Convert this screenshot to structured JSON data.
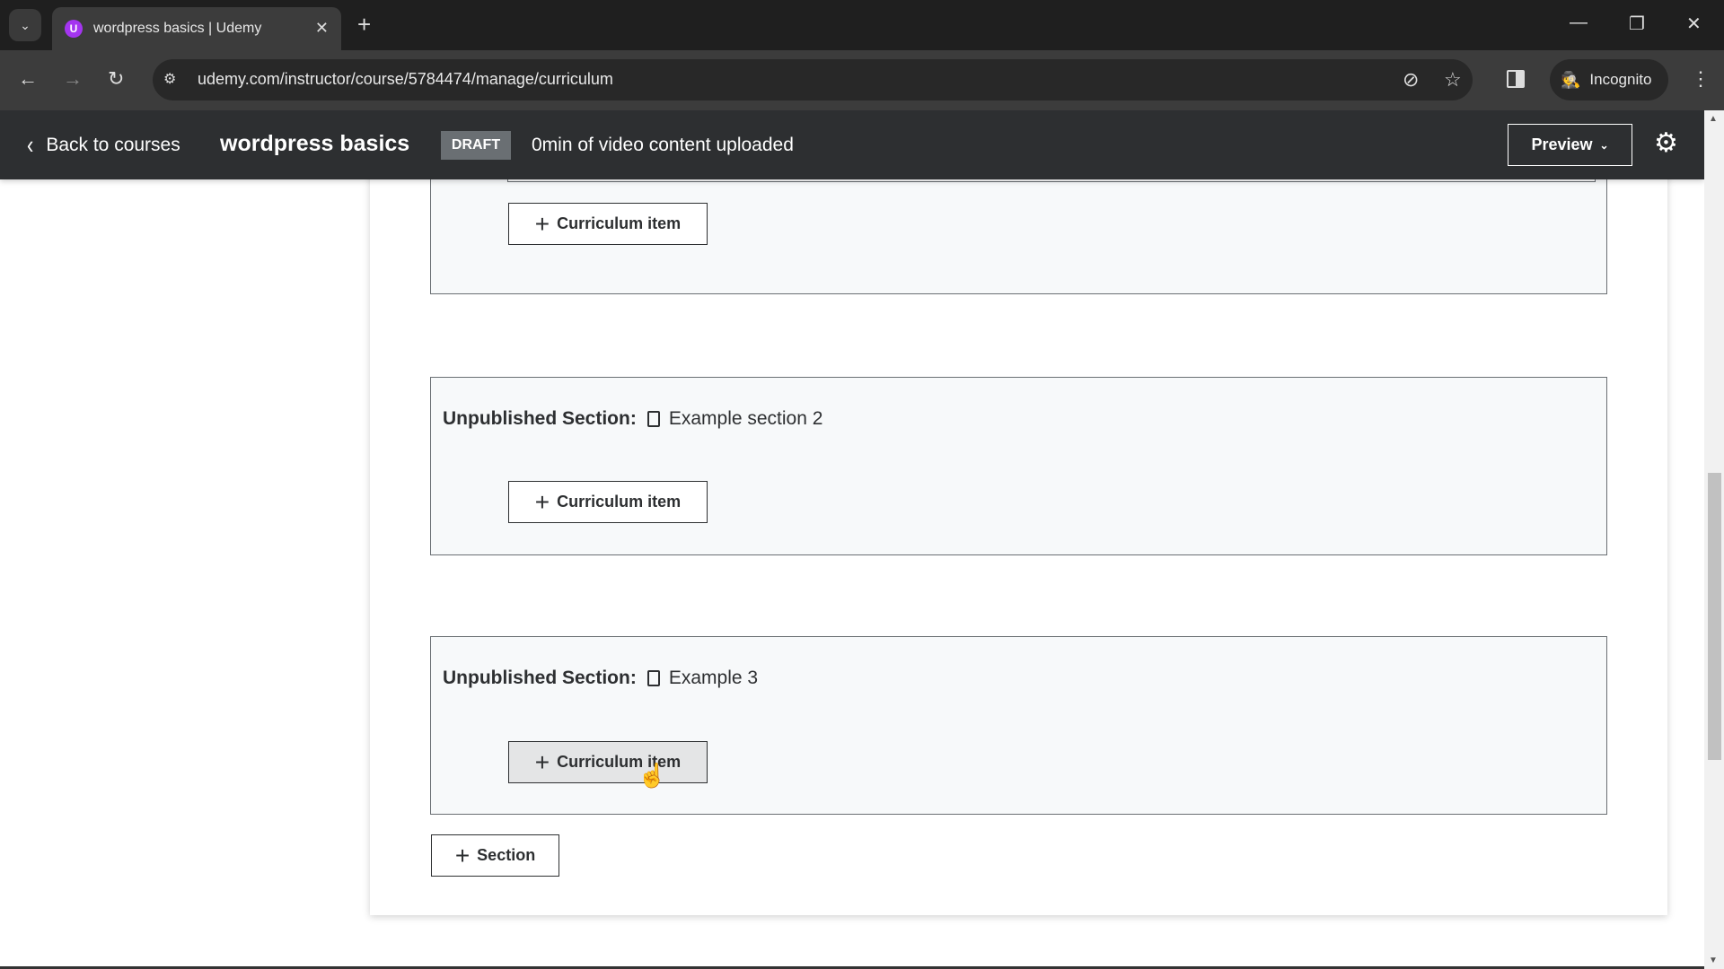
{
  "browser": {
    "tab_title": "wordpress basics | Udemy",
    "favicon_letter": "U",
    "url": "udemy.com/instructor/course/5784474/manage/curriculum",
    "incognito_label": "Incognito",
    "icons": {
      "tab_list": "⌄",
      "close": "✕",
      "new_tab": "+",
      "minimize": "—",
      "restore": "❐",
      "window_close": "✕",
      "back": "←",
      "forward": "→",
      "reload": "↻",
      "site_info": "⚙",
      "eye_off": "⊘",
      "star": "☆",
      "incognito": "🕵",
      "menu": "⋮"
    }
  },
  "header": {
    "back_label": "Back to courses",
    "course_title": "wordpress basics",
    "status_badge": "DRAFT",
    "video_status": "0min of video content uploaded",
    "preview_label": "Preview",
    "chevron_left": "‹",
    "chevron_down": "⌄",
    "gear": "⚙"
  },
  "curriculum": {
    "sections": [
      {
        "label": "",
        "name": "",
        "add_item_label": "Curriculum item"
      },
      {
        "label": "Unpublished Section:",
        "name": "Example section 2",
        "add_item_label": "Curriculum item"
      },
      {
        "label": "Unpublished Section:",
        "name": "Example 3",
        "add_item_label": "Curriculum item"
      }
    ],
    "add_section_label": "Section",
    "plus": "+"
  }
}
